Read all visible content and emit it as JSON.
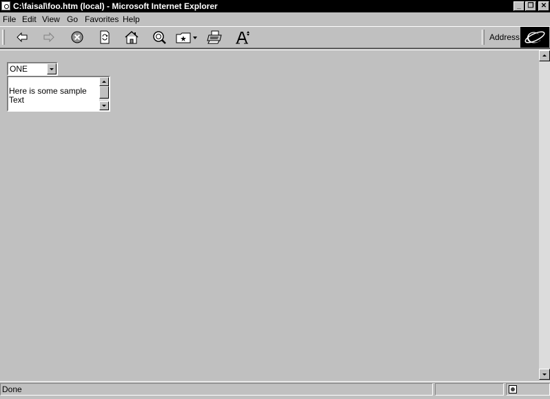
{
  "window": {
    "title": "C:\\faisal\\foo.htm (local) - Microsoft Internet Explorer",
    "minimize_glyph": "_",
    "maximize_glyph": "❐",
    "close_glyph": "✕"
  },
  "menu": {
    "items": [
      "File",
      "Edit",
      "View",
      "Go",
      "Favorites",
      "Help"
    ]
  },
  "toolbar": {
    "icons": [
      "back-icon",
      "forward-icon",
      "stop-icon",
      "refresh-icon",
      "home-icon",
      "search-icon",
      "favorites-icon",
      "print-icon",
      "font-icon"
    ],
    "address_label": "Address"
  },
  "content": {
    "select_value": "ONE",
    "textarea_text": "Here is some sample\nText"
  },
  "status": {
    "text": "Done"
  }
}
